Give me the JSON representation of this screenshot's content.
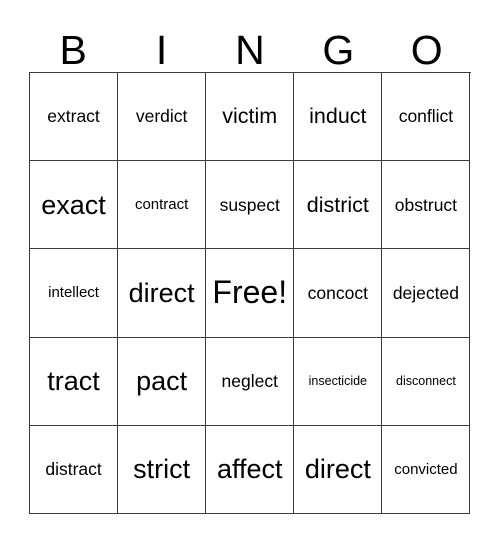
{
  "card": {
    "header_letters": [
      "B",
      "I",
      "N",
      "G",
      "O"
    ],
    "rows": [
      [
        {
          "word": "extract",
          "size": "m"
        },
        {
          "word": "verdict",
          "size": "m"
        },
        {
          "word": "victim",
          "size": "l"
        },
        {
          "word": "induct",
          "size": "l"
        },
        {
          "word": "conflict",
          "size": "m"
        }
      ],
      [
        {
          "word": "exact",
          "size": "xl"
        },
        {
          "word": "contract",
          "size": "s"
        },
        {
          "word": "suspect",
          "size": "m"
        },
        {
          "word": "district",
          "size": "l"
        },
        {
          "word": "obstruct",
          "size": "m"
        }
      ],
      [
        {
          "word": "intellect",
          "size": "s"
        },
        {
          "word": "direct",
          "size": "xl"
        },
        {
          "word": "Free!",
          "size": "xxl"
        },
        {
          "word": "concoct",
          "size": "m"
        },
        {
          "word": "dejected",
          "size": "m"
        }
      ],
      [
        {
          "word": "tract",
          "size": "xl"
        },
        {
          "word": "pact",
          "size": "xl"
        },
        {
          "word": "neglect",
          "size": "m"
        },
        {
          "word": "insecticide",
          "size": "xs"
        },
        {
          "word": "disconnect",
          "size": "xs"
        }
      ],
      [
        {
          "word": "distract",
          "size": "m"
        },
        {
          "word": "strict",
          "size": "xl"
        },
        {
          "word": "affect",
          "size": "xl"
        },
        {
          "word": "direct",
          "size": "xl"
        },
        {
          "word": "convicted",
          "size": "s"
        }
      ]
    ],
    "free_space": {
      "row": 2,
      "column": 2,
      "label": "Free!"
    },
    "colors": {
      "background": "#ffffff",
      "text": "#000000",
      "grid_line": "#3a3a3a"
    }
  }
}
